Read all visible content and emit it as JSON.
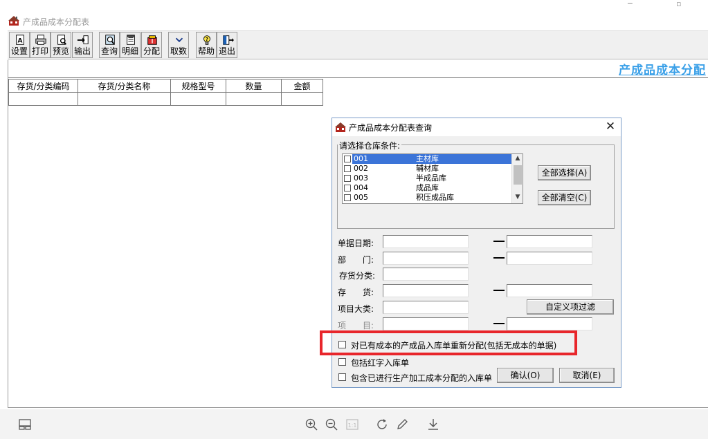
{
  "window": {
    "title": "产成品成本分配表",
    "controls": {
      "minimize": "─",
      "maximize": "▫"
    }
  },
  "toolbar": {
    "buttons": [
      {
        "id": "settings",
        "label": "设置",
        "icon": "settings-doc-icon"
      },
      {
        "id": "print",
        "label": "打印",
        "icon": "printer-icon"
      },
      {
        "id": "preview",
        "label": "预览",
        "icon": "preview-icon"
      },
      {
        "id": "export",
        "label": "输出",
        "icon": "export-icon"
      },
      {
        "id": "query",
        "label": "查询",
        "icon": "query-icon"
      },
      {
        "id": "detail",
        "label": "明细",
        "icon": "detail-icon"
      },
      {
        "id": "allocate",
        "label": "分配",
        "icon": "allocate-icon"
      },
      {
        "id": "fetch",
        "label": "取数",
        "icon": "chevron-down-icon"
      },
      {
        "id": "help",
        "label": "帮助",
        "icon": "help-bulb-icon"
      },
      {
        "id": "exit",
        "label": "退出",
        "icon": "exit-door-icon"
      }
    ]
  },
  "report": {
    "title": "产成品成本分配",
    "columns": [
      "存货/分类编码",
      "存货/分类名称",
      "规格型号",
      "数量",
      "金额"
    ]
  },
  "dialog": {
    "title": "产成品成本分配表查询",
    "close_glyph": "✕",
    "warehouse_group_label": "请选择仓库条件:",
    "warehouses": [
      {
        "code": "001",
        "name": "主材库"
      },
      {
        "code": "002",
        "name": "辅材库"
      },
      {
        "code": "003",
        "name": "半成品库"
      },
      {
        "code": "004",
        "name": "成品库"
      },
      {
        "code": "005",
        "name": "积压成品库"
      }
    ],
    "select_all_label": "全部选择(A)",
    "clear_all_label": "全部清空(C)",
    "fields": {
      "doc_date": "单据日期:",
      "department": "部　　门:",
      "inventory_category": "存货分类:",
      "inventory": "存　　货:",
      "project_major": "项目大类:",
      "project": "项　　目:"
    },
    "range_dash": "—",
    "custom_filter_label": "自定义项过滤",
    "options": {
      "reallocate": "对已有成本的产成品入库单重新分配(包括无成本的单据)",
      "include_red": "包括红字入库单",
      "include_processed": "包含已进行生产加工成本分配的入库单"
    },
    "ok_label": "确认(O)",
    "cancel_label": "取消(E)"
  },
  "colors": {
    "accent_title": "#3aa0e8",
    "selection": "#3b74d8",
    "highlight_box": "#e8262b"
  }
}
